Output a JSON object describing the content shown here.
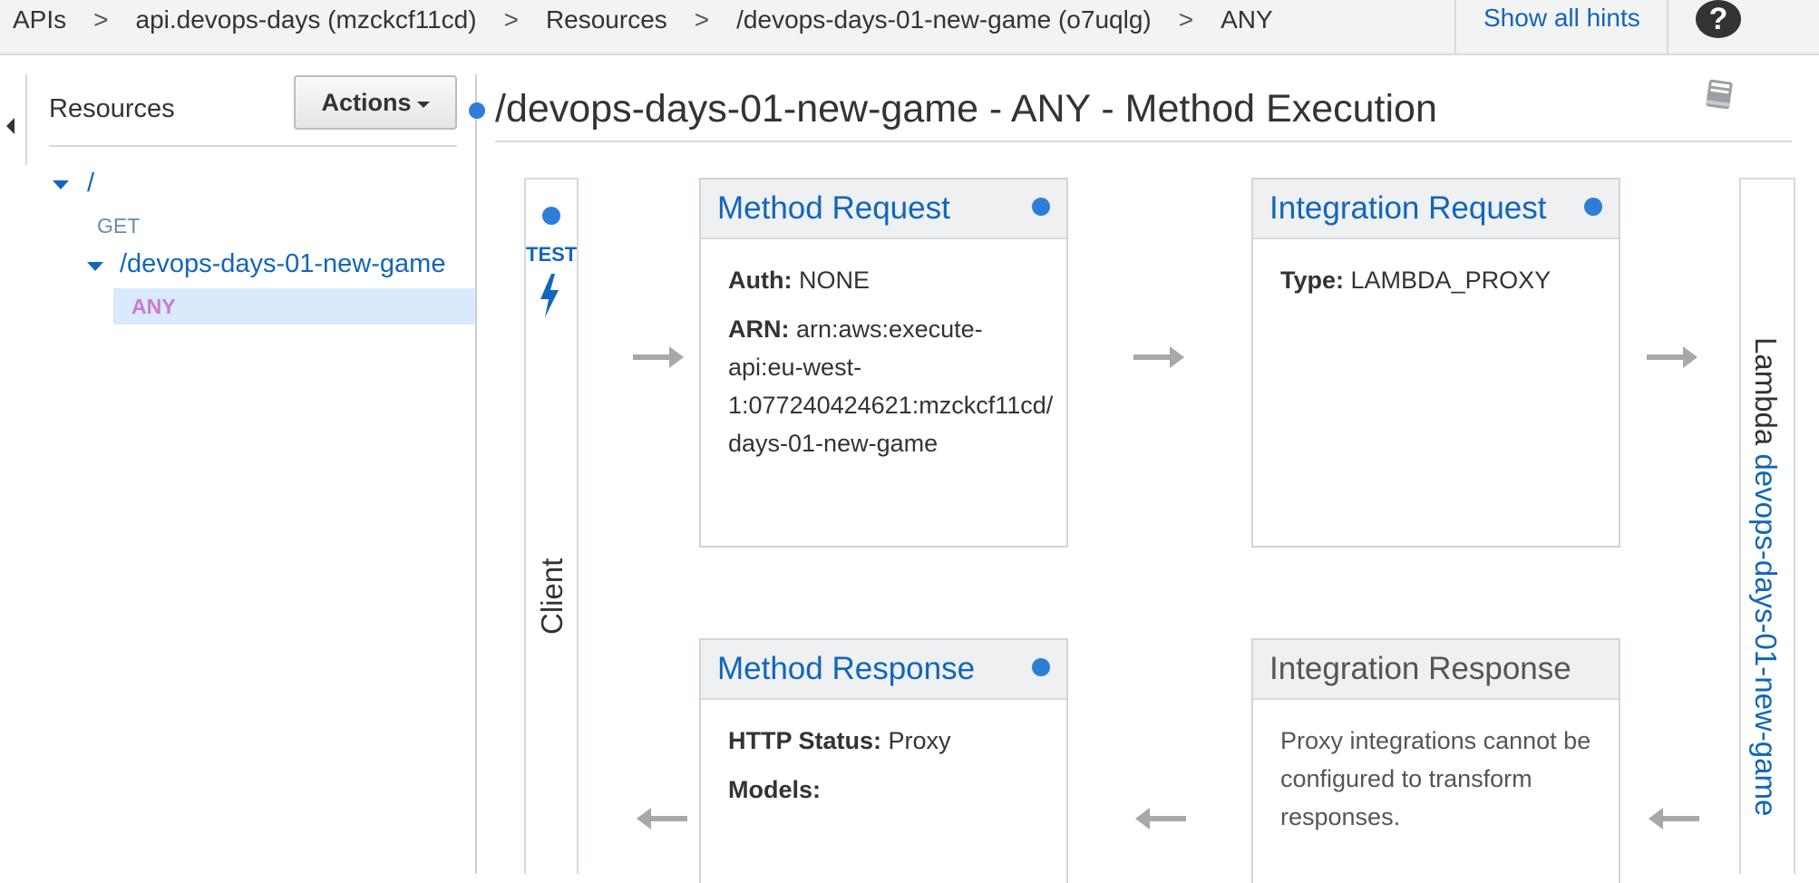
{
  "breadcrumb": {
    "items": [
      "APIs",
      "api.devops-days (mzckcf11cd)",
      "Resources",
      "/devops-days-01-new-game (o7uqlg)",
      "ANY"
    ],
    "separator": ">"
  },
  "header": {
    "show_hints_label": "Show all hints",
    "help_icon_glyph": "?"
  },
  "resources_panel": {
    "title": "Resources",
    "actions_label": "Actions",
    "tree": {
      "root": "/",
      "root_method": "GET",
      "child": "/devops-days-01-new-game",
      "child_method": "ANY"
    }
  },
  "main": {
    "title": "/devops-days-01-new-game - ANY - Method Execution",
    "client": {
      "test_label": "TEST",
      "label": "Client"
    },
    "method_request": {
      "title": "Method Request",
      "auth_label": "Auth:",
      "auth_value": "NONE",
      "arn_label": "ARN:",
      "arn_lines": [
        "arn:aws:execute-",
        "api:eu-west-",
        "1:077240424621:mzckcf11cd/",
        "days-01-new-game"
      ]
    },
    "integration_request": {
      "title": "Integration Request",
      "type_label": "Type:",
      "type_value": "LAMBDA_PROXY"
    },
    "method_response": {
      "title": "Method Response",
      "status_label": "HTTP Status:",
      "status_value": "Proxy",
      "models_label": "Models:"
    },
    "integration_response": {
      "title": "Integration Response",
      "note": "Proxy integrations cannot be configured to transform responses."
    },
    "lambda": {
      "label": "Lambda",
      "function_name": "devops-days-01-new-game"
    }
  },
  "colors": {
    "link": "#1166bb",
    "dot": "#2e7ed8",
    "selected_row": "#d8eafb",
    "selected_method": "#c97ad0"
  }
}
